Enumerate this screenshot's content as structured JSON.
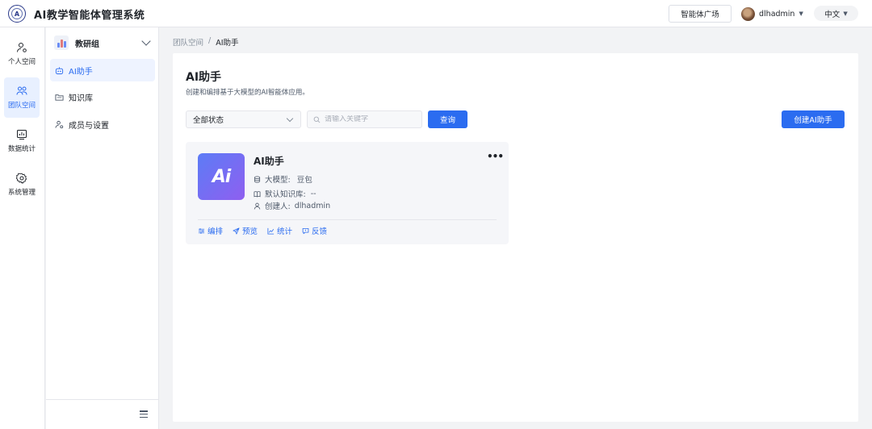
{
  "header": {
    "logo_icon": "school-emblem-icon",
    "logo_letter": "A",
    "title": "AI教学智能体管理系统",
    "plaza_button": "智能体广场",
    "username": "dlhadmin",
    "language": "中文"
  },
  "rail": {
    "items": [
      {
        "label": "个人空间",
        "icon": "person-icon",
        "active": false
      },
      {
        "label": "团队空间",
        "icon": "team-icon",
        "active": true
      },
      {
        "label": "数据统计",
        "icon": "chart-icon",
        "active": false
      },
      {
        "label": "系统管理",
        "icon": "gear-icon",
        "active": false
      }
    ]
  },
  "sidebar": {
    "group_name": "教研组",
    "items": [
      {
        "label": "AI助手",
        "icon": "robot-icon",
        "active": true
      },
      {
        "label": "知识库",
        "icon": "folder-icon",
        "active": false
      },
      {
        "label": "成员与设置",
        "icon": "member-settings-icon",
        "active": false
      }
    ]
  },
  "breadcrumb": {
    "items": [
      "团队空间",
      "AI助手"
    ],
    "separator": "/"
  },
  "main": {
    "title": "AI助手",
    "description": "创建和编排基于大模型的AI智能体应用。",
    "status_select": "全部状态",
    "search_placeholder": "请输入关键字",
    "query_button": "查询",
    "create_button": "创建AI助手"
  },
  "card": {
    "icon_text": "Ai",
    "title": "AI助手",
    "more": "•••",
    "model_label": "大模型:",
    "model_value": "豆包",
    "kb_label": "默认知识库:",
    "kb_value": "--",
    "creator_label": "创建人:",
    "creator_value": "dlhadmin",
    "actions": [
      {
        "label": "编排",
        "icon": "sliders-icon"
      },
      {
        "label": "预览",
        "icon": "send-icon"
      },
      {
        "label": "统计",
        "icon": "line-chart-icon"
      },
      {
        "label": "反馈",
        "icon": "message-icon"
      }
    ]
  },
  "colors": {
    "primary": "#2b6cf0",
    "active_bg": "#e8f0ff",
    "card_gradient_start": "#5c7cf6",
    "card_gradient_end": "#8f5ff0"
  }
}
